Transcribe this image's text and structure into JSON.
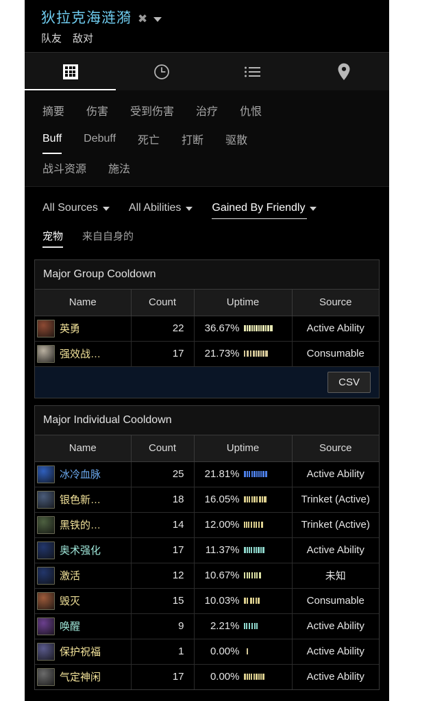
{
  "header": {
    "player_name": "狄拉克海涟漪",
    "close_icon": "close-x-icon",
    "dropdown_icon": "chevron-down-icon",
    "side_tabs": [
      {
        "label": "队友",
        "active": false
      },
      {
        "label": "敌对",
        "active": false
      }
    ]
  },
  "icon_tabs": [
    {
      "name": "grid-icon",
      "active": true
    },
    {
      "name": "clock-icon",
      "active": false
    },
    {
      "name": "list-icon",
      "active": false
    },
    {
      "name": "pin-icon",
      "active": false
    }
  ],
  "subnav": {
    "row1": [
      {
        "label": "摘要",
        "active": false
      },
      {
        "label": "伤害",
        "active": false
      },
      {
        "label": "受到伤害",
        "active": false
      },
      {
        "label": "治疗",
        "active": false
      },
      {
        "label": "仇恨",
        "active": false
      }
    ],
    "row2": [
      {
        "label": "Buff",
        "active": true
      },
      {
        "label": "Debuff",
        "active": false
      },
      {
        "label": "死亡",
        "active": false
      },
      {
        "label": "打断",
        "active": false
      },
      {
        "label": "驱散",
        "active": false
      }
    ],
    "row3": [
      {
        "label": "战斗资源",
        "active": false
      },
      {
        "label": "施法",
        "active": false
      }
    ]
  },
  "filters": {
    "dropdowns": [
      {
        "label": "All Sources",
        "active": false
      },
      {
        "label": "All Abilities",
        "active": false
      },
      {
        "label": "Gained By Friendly",
        "active": true
      }
    ],
    "tags": [
      {
        "label": "宠物",
        "active": true
      },
      {
        "label": "来自自身的",
        "active": false
      }
    ]
  },
  "tables": [
    {
      "title": "Major Group Cooldown",
      "columns": [
        "Name",
        "Count",
        "Uptime",
        "Source"
      ],
      "rows": [
        {
          "name": "英勇",
          "name_color": "#f3e39a",
          "icon_color": "#8d4a33",
          "count": "22",
          "uptime": "36.67%",
          "bar_color": "#e8e9b4",
          "bar": [
            3,
            2,
            3,
            2,
            2,
            3,
            2,
            2,
            3,
            2,
            3,
            4
          ],
          "source": "Active Ability"
        },
        {
          "name": "强效战…",
          "name_color": "#f3e39a",
          "icon_color": "#b9b0a0",
          "count": "17",
          "uptime": "21.73%",
          "bar_color": "#d6c99a",
          "bar": [
            2,
            0,
            3,
            0,
            2,
            0,
            3,
            2,
            3,
            2,
            3,
            4
          ],
          "source": "Consumable"
        }
      ],
      "footer_button": "CSV"
    },
    {
      "title": "Major Individual Cooldown",
      "columns": [
        "Name",
        "Count",
        "Uptime",
        "Source"
      ],
      "rows": [
        {
          "name": "冰冷血脉",
          "name_color": "#6ba8ee",
          "icon_color": "#2f5fbd",
          "count": "25",
          "uptime": "21.81%",
          "bar_color": "#4d7fe8",
          "bar": [
            3,
            2,
            2,
            0,
            2,
            3,
            2,
            2,
            2,
            3,
            3
          ],
          "source": "Active Ability"
        },
        {
          "name": "银色新…",
          "name_color": "#f3e39a",
          "icon_color": "#4a5c7a",
          "count": "18",
          "uptime": "16.05%",
          "bar_color": "#ddd08f",
          "bar": [
            3,
            2,
            2,
            0,
            2,
            3,
            2,
            0,
            3,
            2,
            4
          ],
          "source": "Trinket (Active)"
        },
        {
          "name": "黑铁的…",
          "name_color": "#f3e39a",
          "icon_color": "#4d6040",
          "count": "14",
          "uptime": "12.00%",
          "bar_color": "#ddd08f",
          "bar": [
            2,
            2,
            2,
            0,
            2,
            0,
            2,
            2,
            0,
            2,
            0,
            3
          ],
          "source": "Trinket (Active)"
        },
        {
          "name": "奥术强化",
          "name_color": "#9fe6d9",
          "icon_color": "#22366b",
          "count": "17",
          "uptime": "11.37%",
          "bar_color": "#8fd8cd",
          "bar": [
            3,
            2,
            2,
            2,
            0,
            2,
            2,
            3,
            2,
            3
          ],
          "source": "Active Ability"
        },
        {
          "name": "激活",
          "name_color": "#f3e39a",
          "icon_color": "#22366b",
          "count": "12",
          "uptime": "10.67%",
          "bar_color": "#dde2a5",
          "bar": [
            2,
            0,
            2,
            2,
            0,
            2,
            0,
            2,
            2,
            0,
            3
          ],
          "source": "未知"
        },
        {
          "name": "毁灭",
          "name_color": "#f3e39a",
          "icon_color": "#9c5a3a",
          "count": "15",
          "uptime": "10.03%",
          "bar_color": "#ddd08f",
          "bar": [
            3,
            2,
            0,
            0,
            3,
            2,
            0,
            2,
            3
          ],
          "source": "Consumable"
        },
        {
          "name": "唤醒",
          "name_color": "#9fe6d9",
          "icon_color": "#6b3f8e",
          "count": "9",
          "uptime": "2.21%",
          "bar_color": "#8fd8cd",
          "bar": [
            2,
            2,
            0,
            2,
            0,
            2,
            0,
            2,
            2
          ],
          "source": "Active Ability"
        },
        {
          "name": "保护祝福",
          "name_color": "#f3e39a",
          "icon_color": "#5a5a8c",
          "count": "1",
          "uptime": "0.00%",
          "bar_color": "#d6c99a",
          "bar": [
            0,
            0,
            0,
            0,
            2,
            0,
            0,
            0,
            0
          ],
          "source": "Active Ability"
        },
        {
          "name": "气定神闲",
          "name_color": "#f3e39a",
          "icon_color": "#6b6b6b",
          "count": "17",
          "uptime": "0.00%",
          "bar_color": "#ddd08f",
          "bar": [
            3,
            2,
            2,
            2,
            0,
            2,
            3,
            2,
            2,
            3
          ],
          "source": "Active Ability"
        }
      ]
    }
  ]
}
